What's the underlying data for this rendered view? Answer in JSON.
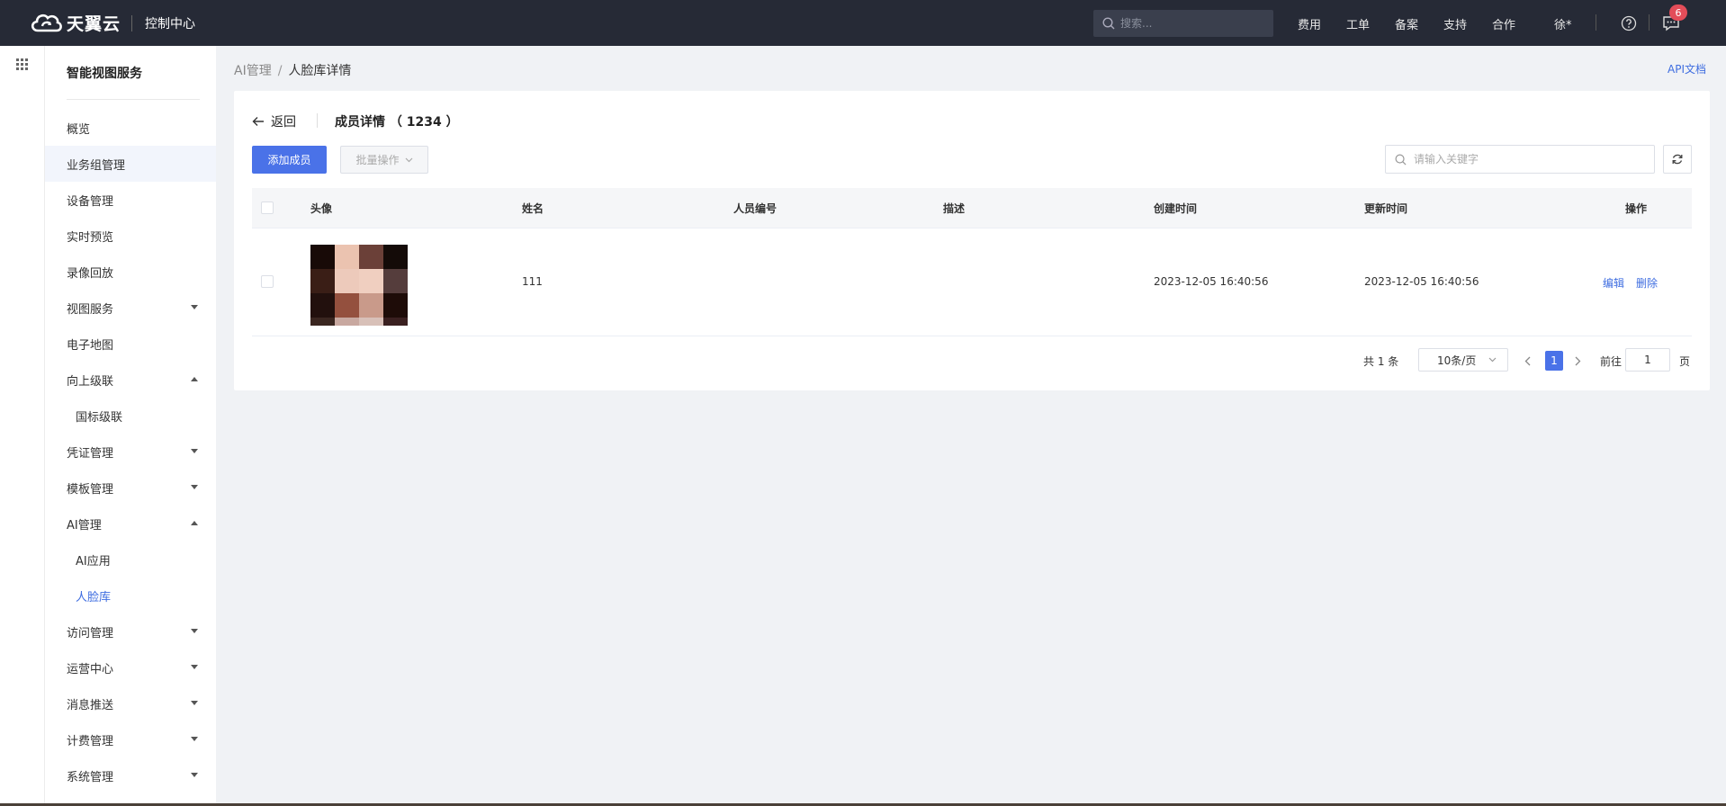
{
  "topbar": {
    "logo_text": "天翼云",
    "console_label": "控制中心",
    "search_placeholder": "搜索...",
    "nav": [
      "费用",
      "工单",
      "备案",
      "支持",
      "合作"
    ],
    "user": "徐*",
    "message_count": "6"
  },
  "sidebar": {
    "title": "智能视图服务",
    "items": [
      {
        "label": "概览",
        "arrow": ""
      },
      {
        "label": "业务组管理",
        "arrow": ""
      },
      {
        "label": "设备管理",
        "arrow": ""
      },
      {
        "label": "实时预览",
        "arrow": ""
      },
      {
        "label": "录像回放",
        "arrow": ""
      },
      {
        "label": "视图服务",
        "arrow": "down"
      },
      {
        "label": "电子地图",
        "arrow": ""
      },
      {
        "label": "向上级联",
        "arrow": "up"
      },
      {
        "label": "国标级联",
        "arrow": "",
        "sub": true
      },
      {
        "label": "凭证管理",
        "arrow": "down"
      },
      {
        "label": "模板管理",
        "arrow": "down"
      },
      {
        "label": "AI管理",
        "arrow": "up"
      },
      {
        "label": "AI应用",
        "arrow": "",
        "sub": true
      },
      {
        "label": "人脸库",
        "arrow": "",
        "sub": true,
        "selected": true
      },
      {
        "label": "访问管理",
        "arrow": "down"
      },
      {
        "label": "运营中心",
        "arrow": "down"
      },
      {
        "label": "消息推送",
        "arrow": "down"
      },
      {
        "label": "计费管理",
        "arrow": "down"
      },
      {
        "label": "系统管理",
        "arrow": "down"
      }
    ]
  },
  "breadcrumb": {
    "parent": "AI管理",
    "separator": "/",
    "current": "人脸库详情"
  },
  "api_doc": "API文档",
  "card": {
    "back_label": "返回",
    "title": "成员详情 （ 1234 ）",
    "add_button": "添加成员",
    "batch_button": "批量操作",
    "keyword_placeholder": "请输入关键字"
  },
  "table": {
    "headers": [
      "头像",
      "姓名",
      "人员编号",
      "描述",
      "创建时间",
      "更新时间",
      "操作"
    ],
    "rows": [
      {
        "name": "111",
        "number": "",
        "description": "",
        "created": "2023-12-05 16:40:56",
        "updated": "2023-12-05 16:40:56",
        "edit": "编辑",
        "delete": "删除"
      }
    ]
  },
  "pagination": {
    "total": "共 1 条",
    "page_size": "10条/页",
    "current_page": "1",
    "goto_label": "前往",
    "goto_value": "1",
    "page_suffix": "页"
  },
  "colors": {
    "topbar_bg": "#262a36",
    "primary": "#4a72e8",
    "link": "#3e6de0",
    "badge": "#e34d59",
    "main_bg": "#f0f2f5"
  }
}
